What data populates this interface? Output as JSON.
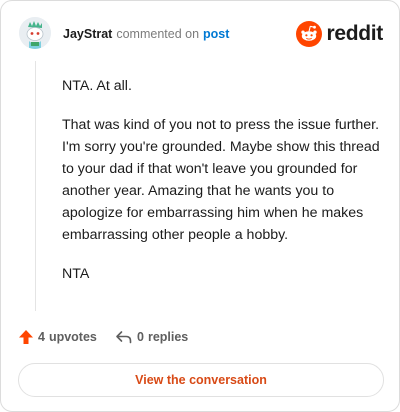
{
  "header": {
    "username": "JayStrat",
    "action_text": "commented on",
    "post_link": "post",
    "brand_name": "reddit"
  },
  "comment": {
    "paragraphs": [
      "NTA. At all.",
      "That was kind of you not to press the issue further. I'm sorry you're grounded. Maybe show this thread to your dad if that won't leave you grounded for another year. Amazing that he wants you to apologize for embarrassing him when he makes embarrassing other people a hobby.",
      "NTA"
    ]
  },
  "footer": {
    "upvotes": "4",
    "upvotes_label": "upvotes",
    "replies": "0",
    "replies_label": "replies"
  },
  "cta": {
    "label": "View the conversation"
  },
  "colors": {
    "accent": "#ff4500",
    "cta_text": "#d84a16",
    "link": "#0079d3",
    "muted": "#7c7c7c"
  },
  "icons": {
    "avatar": "snoo-avatar",
    "logo": "reddit-alien-icon",
    "upvote": "upvote-arrow-icon",
    "reply": "reply-arrow-icon"
  }
}
